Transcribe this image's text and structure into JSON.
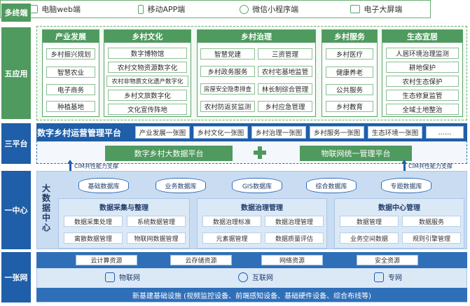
{
  "layers": {
    "terminals": "多终端",
    "apps": "五应用",
    "platforms": "三平台",
    "center": "一中心",
    "network": "一张网"
  },
  "terminals": [
    "电脑web端",
    "移动APP端",
    "微信小程序端",
    "电子大屏端"
  ],
  "apps": [
    {
      "title": "产业发展",
      "items": [
        "乡村振兴规划",
        "智慧农业",
        "电子商务",
        "种植基地"
      ]
    },
    {
      "title": "乡村文化",
      "items": [
        "数字博物馆",
        "农村文物资源数字化",
        "农村非物质文化遗产数字化",
        "乡村文旅数字化",
        "文化宣传阵地"
      ]
    },
    {
      "title": "乡村治理",
      "items": [
        "智慧党建",
        "三资管理",
        "乡村政务服务",
        "农村宅基地监管",
        "房屋安全隐患排查",
        "林长制综合管理",
        "农村防返贫监测",
        "乡村应急管理"
      ]
    },
    {
      "title": "乡村服务",
      "items": [
        "乡村医疗",
        "健康养老",
        "公共服务",
        "乡村教育"
      ]
    },
    {
      "title": "生态宜居",
      "items": [
        "人居环境治理监测",
        "耕地保护",
        "农村生态保护",
        "生态修复监管",
        "全域土地整治"
      ]
    }
  ],
  "platform": {
    "title": "数字乡村运营管理平台",
    "screens": [
      "产业发展一张图",
      "乡村文化一张图",
      "乡村治理一张图",
      "乡村服务一张图",
      "生态环境一张图",
      "……"
    ],
    "bigdata": "数字乡村大数据平台",
    "iot": "物联网统一管理平台",
    "cim_left": "CIM共性能力支撑",
    "cim_right": "CIM共性能力支撑"
  },
  "center": {
    "title": [
      "大",
      "数",
      "据",
      "中",
      "心"
    ],
    "databases": [
      "基础数据库",
      "业务数据库",
      "GIS数据库",
      "综合数据库",
      "专题数据库"
    ],
    "modules": [
      {
        "title": "数据采集与整理",
        "items": [
          "数据采集处理",
          "系统数据管理",
          "离散数据管理",
          "物联网数据管理"
        ]
      },
      {
        "title": "数据治理管理",
        "items": [
          "数据治理标准",
          "数据治理管理",
          "元素据管理",
          "数据质量评估"
        ]
      },
      {
        "title": "数据中心管理",
        "items": [
          "数据管理",
          "数据服务",
          "业务空间数据",
          "规则引擎管理"
        ]
      }
    ]
  },
  "network": {
    "resources": [
      "云计算资源",
      "云存储资源",
      "网络资源",
      "安全资源"
    ],
    "nets": [
      "物联网",
      "互联网",
      "专网"
    ],
    "infra": "新基建基础设施 (视频监控设备、前端感知设备、基础硬件设备、综合布线等)"
  },
  "colors": {
    "green": "#4f9a5e",
    "blue": "#1f5ea8"
  }
}
